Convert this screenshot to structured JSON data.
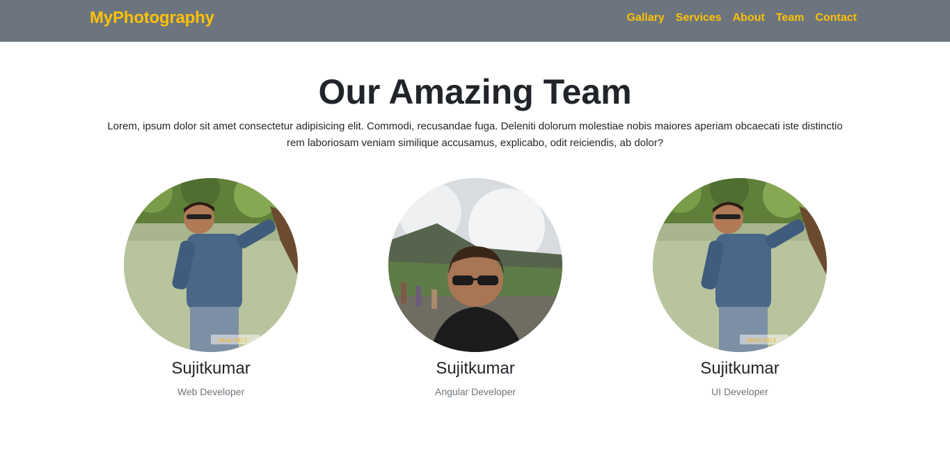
{
  "navbar": {
    "brand": "MyPhotography",
    "links": [
      "Gallary",
      "Services",
      "About",
      "Team",
      "Contact"
    ],
    "accent_color": "#ffc107",
    "background_color": "#6c757d"
  },
  "main": {
    "title": "Our Amazing Team",
    "lead": "Lorem, ipsum dolor sit amet consectetur adipisicing elit. Commodi, recusandae fuga. Deleniti dolorum molestiae nobis maiores aperiam obcaecati iste distinctio rem laboriosam veniam similique accusamus, explicabo, odit reiciendis, ab dolor?"
  },
  "team": [
    {
      "name": "Sujitkumar",
      "role": "Web Developer",
      "photo_stamp": "2016/10/1"
    },
    {
      "name": "Sujitkumar",
      "role": "Angular Developer"
    },
    {
      "name": "Sujitkumar",
      "role": "UI Developer",
      "photo_stamp": "2016/10/1"
    }
  ]
}
